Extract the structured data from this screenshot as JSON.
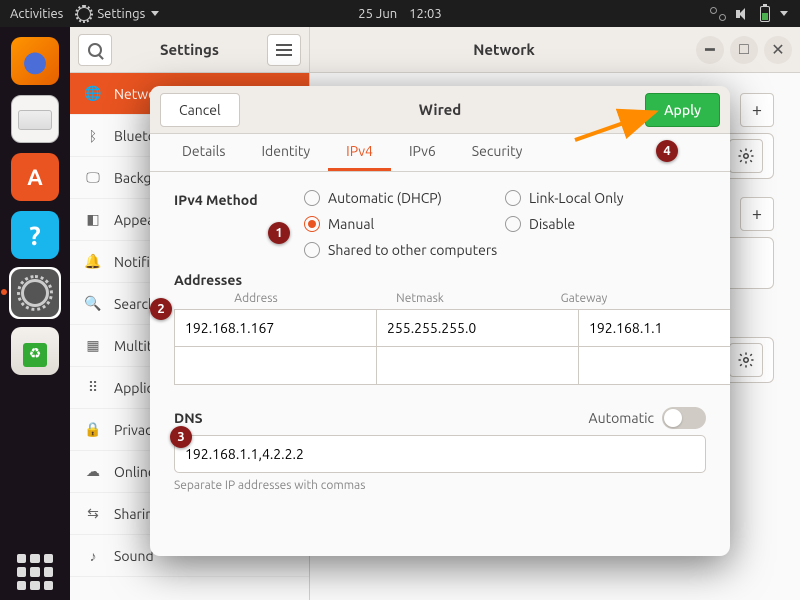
{
  "topbar": {
    "activities": "Activities",
    "app_label": "Settings",
    "date": "25 Jun",
    "time": "12:03"
  },
  "dock": {
    "items": [
      "firefox",
      "files",
      "software",
      "help",
      "settings",
      "trash"
    ]
  },
  "settings": {
    "sidebar_title": "Settings",
    "categories": [
      {
        "icon": "globe",
        "label": "Network"
      },
      {
        "icon": "bt",
        "label": "Bluetooth"
      },
      {
        "icon": "display",
        "label": "Background"
      },
      {
        "icon": "grid",
        "label": "Appearance"
      },
      {
        "icon": "bell",
        "label": "Notifications"
      },
      {
        "icon": "search",
        "label": "Search"
      },
      {
        "icon": "stack",
        "label": "Multitasking"
      },
      {
        "icon": "apps",
        "label": "Applications"
      },
      {
        "icon": "lock",
        "label": "Privacy"
      },
      {
        "icon": "cloud",
        "label": "Online Accounts"
      },
      {
        "icon": "share",
        "label": "Sharing"
      },
      {
        "icon": "sound",
        "label": "Sound"
      }
    ]
  },
  "main": {
    "title": "Network",
    "plus": "+"
  },
  "modal": {
    "title": "Wired",
    "cancel": "Cancel",
    "apply": "Apply",
    "tabs": [
      "Details",
      "Identity",
      "IPv4",
      "IPv6",
      "Security"
    ],
    "active_tab": 2,
    "method_label": "IPv4 Method",
    "methods": {
      "auto": "Automatic (DHCP)",
      "linklocal": "Link-Local Only",
      "manual": "Manual",
      "disable": "Disable",
      "shared": "Shared to other computers"
    },
    "addresses_label": "Addresses",
    "addr_headers": {
      "address": "Address",
      "netmask": "Netmask",
      "gateway": "Gateway"
    },
    "rows": [
      {
        "address": "192.168.1.167",
        "netmask": "255.255.255.0",
        "gateway": "192.168.1.1"
      },
      {
        "address": "",
        "netmask": "",
        "gateway": ""
      }
    ],
    "dns_label": "DNS",
    "dns_auto_label": "Automatic",
    "dns_value": "192.168.1.1,4.2.2.2",
    "dns_hint": "Separate IP addresses with commas"
  },
  "anno": {
    "1": "1",
    "2": "2",
    "3": "3",
    "4": "4"
  }
}
